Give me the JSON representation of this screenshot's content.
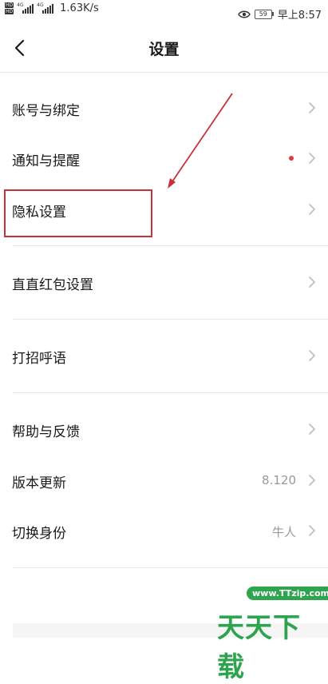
{
  "status_bar": {
    "hd_top": "HD",
    "hd_bottom": "HD",
    "net_1": "4G",
    "net_2": "4G",
    "speed": "1.63K/s",
    "battery": "59",
    "time": "早上8:57"
  },
  "header": {
    "title": "设置"
  },
  "settings": {
    "account": {
      "label": "账号与绑定"
    },
    "notify": {
      "label": "通知与提醒"
    },
    "privacy": {
      "label": "隐私设置"
    },
    "redpacket": {
      "label": "直直红包设置"
    },
    "greeting": {
      "label": "打招呼语"
    },
    "help": {
      "label": "帮助与反馈"
    },
    "version": {
      "label": "版本更新",
      "value": "8.120"
    },
    "identity": {
      "label": "切换身份",
      "value": "牛人"
    }
  },
  "colors": {
    "annotation": "#c9303a",
    "badge_dot": "#e23a3a",
    "watermark": "#2ea44f"
  },
  "watermark": {
    "url": "www.TTzip.com",
    "text": "天天下载"
  }
}
